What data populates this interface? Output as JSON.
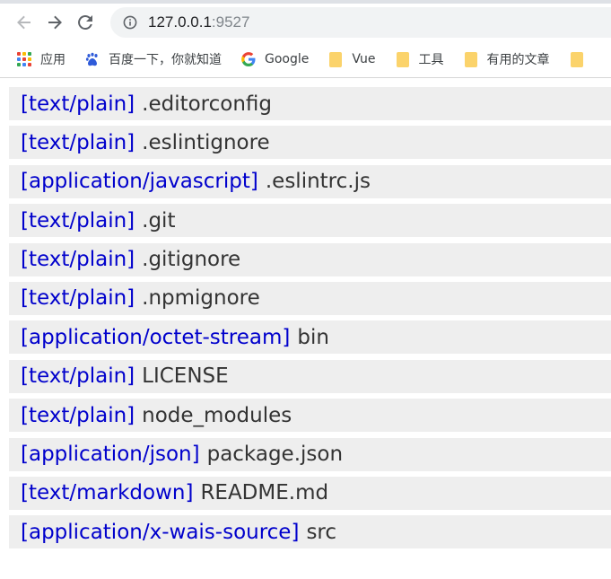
{
  "browser": {
    "url_host": "127.0.0.1",
    "url_port": ":9527"
  },
  "bookmarks": [
    {
      "label": "应用",
      "icon": "apps-grid-icon"
    },
    {
      "label": "百度一下，你就知道",
      "icon": "baidu-paw-icon"
    },
    {
      "label": "Google",
      "icon": "google-g-icon"
    },
    {
      "label": "Vue",
      "icon": "folder-icon"
    },
    {
      "label": "工具",
      "icon": "folder-icon"
    },
    {
      "label": "有用的文章",
      "icon": "folder-icon"
    }
  ],
  "files": [
    {
      "mime": "[text/plain]",
      "name": ".editorconfig"
    },
    {
      "mime": "[text/plain]",
      "name": ".eslintignore"
    },
    {
      "mime": "[application/javascript]",
      "name": ".eslintrc.js"
    },
    {
      "mime": "[text/plain]",
      "name": ".git"
    },
    {
      "mime": "[text/plain]",
      "name": ".gitignore"
    },
    {
      "mime": "[text/plain]",
      "name": ".npmignore"
    },
    {
      "mime": "[application/octet-stream]",
      "name": "bin"
    },
    {
      "mime": "[text/plain]",
      "name": "LICENSE"
    },
    {
      "mime": "[text/plain]",
      "name": "node_modules"
    },
    {
      "mime": "[application/json]",
      "name": "package.json"
    },
    {
      "mime": "[text/markdown]",
      "name": "README.md"
    },
    {
      "mime": "[application/x-wais-source]",
      "name": "src"
    }
  ],
  "colors": {
    "mime_link": "#0000cc",
    "row_background": "#eeeeee",
    "folder": "#fbd36b"
  }
}
